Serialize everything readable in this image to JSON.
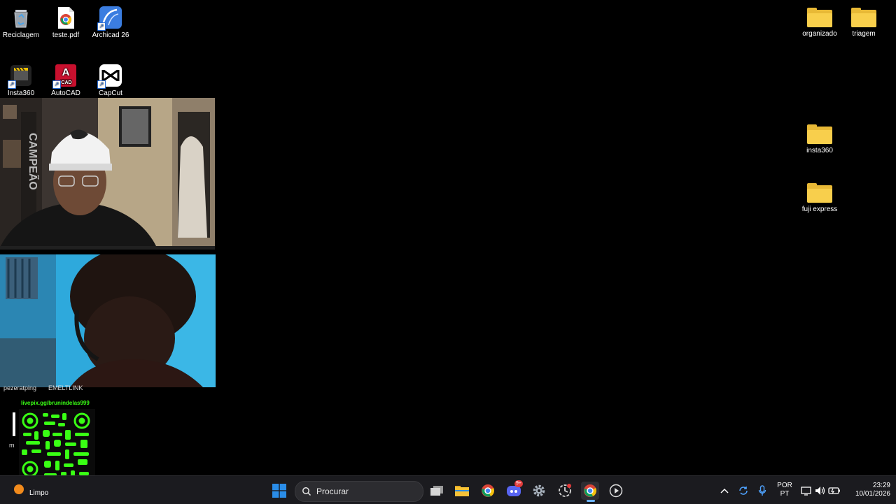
{
  "desktop": {
    "left_icons": [
      {
        "label": "Reciclagem",
        "icon": "recycle-bin-icon"
      },
      {
        "label": "teste.pdf",
        "icon": "chrome-pdf-icon"
      },
      {
        "label": "Archicad 26",
        "icon": "archicad-icon"
      },
      {
        "label": "Insta360",
        "icon": "insta360-app-icon"
      },
      {
        "label": "AutoCAD",
        "icon": "autocad-icon"
      },
      {
        "label": "CapCut",
        "icon": "capcut-icon"
      }
    ],
    "right_icons": [
      {
        "label": "organizado",
        "icon": "folder-icon"
      },
      {
        "label": "triagem",
        "icon": "folder-icon"
      },
      {
        "label": "insta360",
        "icon": "folder-icon"
      },
      {
        "label": "fuji express",
        "icon": "folder-icon"
      }
    ]
  },
  "overlay": {
    "cam2_name_left": "pezeratping",
    "cam2_name_right": "EMELTLINK",
    "livepix_url": "livepix.gg/brunindelas999",
    "side_letter": "m"
  },
  "autocad_badge": "CAD",
  "autocad_letter": "A",
  "taskbar": {
    "weather_label": "Limpo",
    "search_placeholder": "Procurar",
    "discord_badge": "9+",
    "lang_line1": "POR",
    "lang_line2": "PT",
    "time": "23:29",
    "date": "10/01/2026"
  },
  "colors": {
    "folder": "#f8cf4c",
    "qr_green": "#39ff14",
    "taskbar_bg": "#1b1b1f",
    "win_blue": "#2a8de8"
  }
}
